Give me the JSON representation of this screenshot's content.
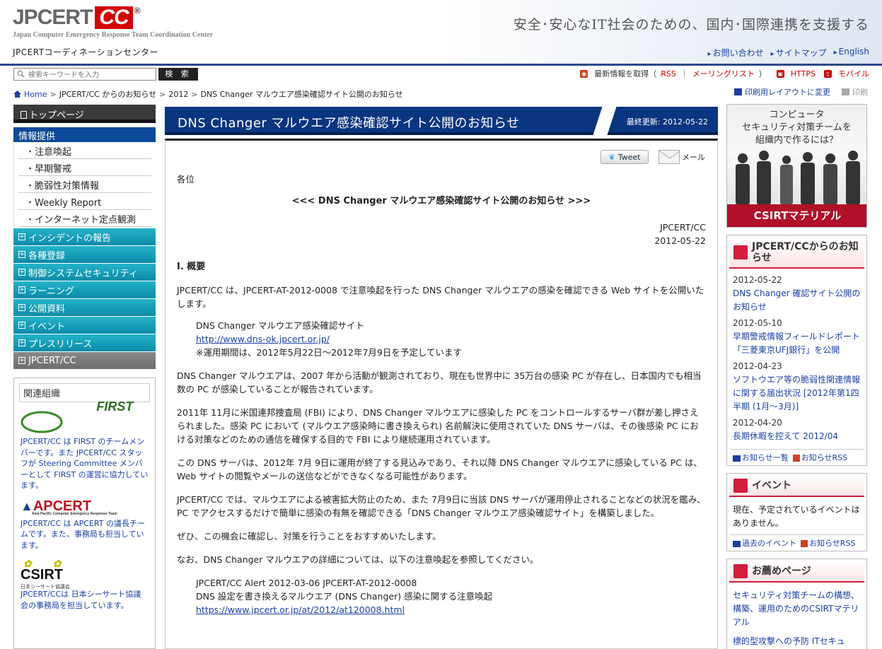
{
  "header": {
    "logo_main": "JPCERT",
    "logo_cc": "CC",
    "logo_reg": "®",
    "logo_sub": "Japan Computer Emergency Response Team Coordination Center",
    "logo_jp": "JPCERTコーディネーションセンター",
    "tagline": "安全･安心なIT社会のための、国内･国際連携を支援する",
    "links": [
      "お問い合わせ",
      "サイトマップ",
      "English"
    ]
  },
  "search": {
    "placeholder": "検索キーワードを入力",
    "button": "検 索"
  },
  "feeds": {
    "prefix": "最新情報を取得（",
    "rss": "RSS",
    "sep": "｜",
    "mailing": "メーリングリスト",
    "suffix": "）",
    "https": "HTTPS",
    "mobile": "モバイル"
  },
  "breadcrumb": [
    "Home",
    "JPCERT/CC からのお知らせ",
    "2012",
    "DNS Changer マルウエア感染確認サイト公開のお知らせ"
  ],
  "print": {
    "layout": "印刷用レイアウトに変更",
    "print": "印刷"
  },
  "nav": {
    "top": "トップページ",
    "section": "情報提供",
    "sub": [
      "注意喚起",
      "早期警戒",
      "脆弱性対策情報",
      "Weekly Report",
      "インターネット定点観測"
    ],
    "cats": [
      "インシデントの報告",
      "各種登録",
      "制御システムセキュリティ",
      "ラーニング",
      "公開資料",
      "イベント",
      "プレスリリース"
    ],
    "last": "JPCERT/CC"
  },
  "related": {
    "title": "関連組織",
    "orgs": [
      {
        "logo": "FIRST",
        "text": "JPCERT/CC は FIRST のチームメンバーです。また JPCERT/CC スタッフが Steering Committee メンバーとして FIRST の運営に協力しています。"
      },
      {
        "logo": "APCERT",
        "logo_sub": "Asia Pacific Computer Emergency Response Team",
        "text": "JPCERT/CC は APCERT の議長チームです。また、事務局も担当しています。"
      },
      {
        "logo": "CSIRT",
        "logo_sub": "日本シーサート協議会",
        "text": "JPCERT/CCは 日本シーサート協議会の事務局を担当しています。"
      }
    ]
  },
  "main": {
    "title": "DNS Changer マルウエア感染確認サイト公開のお知らせ",
    "updated": "最終更新: 2012-05-22",
    "tweet": "Tweet",
    "mail": "メール",
    "salutation": "各位",
    "center_title": "<<< DNS Changer マルウエア感染確認サイト公開のお知らせ >>>",
    "org": "JPCERT/CC",
    "date": "2012-05-22",
    "h_overview": "I. 概要",
    "p1": "JPCERT/CC は、JPCERT-AT-2012-0008 で注意喚起を行った DNS Changer マルウエアの感染を確認できる Web サイトを公開いたします。",
    "site_name": "DNS Changer マルウエア感染確認サイト",
    "site_url": "http://www.dns-ok.jpcert.or.jp/",
    "site_note": "※運用期間は、2012年5月22日～2012年7月9日を予定しています",
    "p2": "DNS Changer マルウエアは、2007 年から活動が観測されており、現在も世界中に 35万台の感染 PC が存在し、日本国内でも相当数の PC が感染していることが報告されています。",
    "p3": "2011年 11月に米国連邦捜査局 (FBI) により、DNS Changer マルウエアに感染した PC をコントロールするサーバ群が差し押さえられました。感染 PC において (マルウエア感染時に書き換えられ) 名前解決に使用されていた DNS サーバは、その後感染 PC における対策などのための通信を確保する目的で FBI により継続運用されています。",
    "p4": "この DNS サーバは、2012年 7月 9日に運用が終了する見込みであり、それ以降 DNS Changer マルウエアに感染している PC は、Web サイトの閲覧やメールの送信などができなくなる可能性があります。",
    "p5": "JPCERT/CC では、マルウエアによる被害拡大防止のため、また 7月9日に当該 DNS サーバが運用停止されることなどの状況を鑑み、PC でアクセスするだけで簡単に感染の有無を確認できる「DNS Changer マルウエア感染確認サイト」を構築しました。",
    "p6": "ぜひ、この機会に確認し、対策を行うことをおすすめいたします。",
    "p7": "なお、DNS Changer マルウエアの詳細については、以下の注意喚起を参照してください。",
    "alert_line1": "JPCERT/CC Alert 2012-03-06 JPCERT-AT-2012-0008",
    "alert_line2": "DNS 設定を書き換えるマルウエア (DNS Changer) 感染に関する注意喚起",
    "alert_url": "https://www.jpcert.or.jp/at/2012/at120008.html"
  },
  "right": {
    "banner_text": [
      "コンピュータ",
      "セキュリティ対策チームを",
      "組織内で作るには？"
    ],
    "banner_cap": "CSIRTマテリアル",
    "news_title": "JPCERT/CCからのお知らせ",
    "news": [
      {
        "date": "2012-05-22",
        "title": "DNS Changer 確認サイト公開のお知らせ"
      },
      {
        "date": "2012-05-10",
        "title": "早期警戒情報フィールドレポート「三菱東京UFJ銀行」を公開"
      },
      {
        "date": "2012-04-23",
        "title": "ソフトウエア等の脆弱性関連情報に関する届出状況 [2012年第1四半期 (1月～3月)]"
      },
      {
        "date": "2012-04-20",
        "title": "長期休暇を控えて 2012/04"
      }
    ],
    "news_list": "お知らせ一覧",
    "news_rss": "お知らせRSS",
    "event_title": "イベント",
    "event_text": "現在、予定されているイベントはありません。",
    "event_past": "過去のイベント",
    "event_rss": "お知らせRSS",
    "rec_title": "お薦めページ",
    "rec": [
      "セキュリティ対策チームの構想、構築、運用のためのCSIRTマテリアル",
      "標的型攻撃への予防 ITセキュ"
    ]
  }
}
